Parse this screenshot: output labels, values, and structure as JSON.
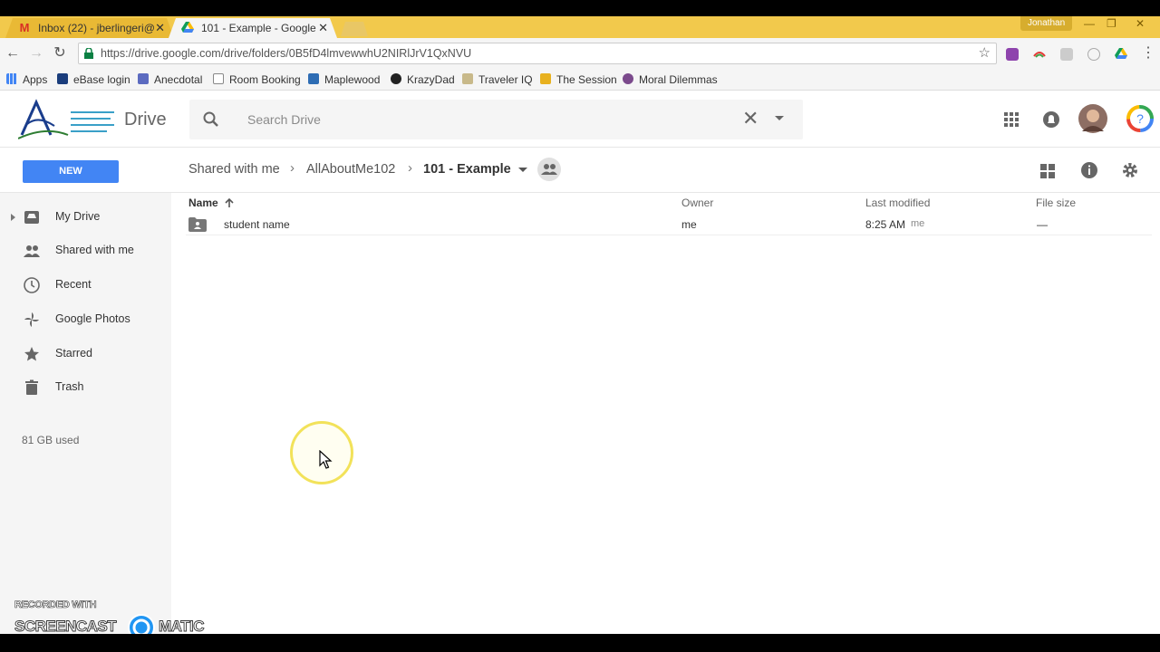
{
  "browser": {
    "tabs": [
      {
        "title": "Inbox (22) - jberlingeri@",
        "icon": "gmail-icon",
        "active": false
      },
      {
        "title": "101 - Example - Google",
        "icon": "google-drive-icon",
        "active": true
      }
    ],
    "profile_name": "Jonathan",
    "url": "https://drive.google.com/drive/folders/0B5fD4lmvewwhU2NIRlJrV1QxNVU",
    "bookmarks": [
      {
        "label": "Apps",
        "icon": "apps-grid-icon",
        "color": "#4285f4"
      },
      {
        "label": "eBase login",
        "icon": "ebase-icon",
        "color": "#1a3d7c"
      },
      {
        "label": "Anecdotal",
        "icon": "anecdotal-icon",
        "color": "#5c6bc0"
      },
      {
        "label": "Room Booking",
        "icon": "page-icon",
        "color": "#ffffff"
      },
      {
        "label": "Maplewood",
        "icon": "maplewood-icon",
        "color": "#2e6db4"
      },
      {
        "label": "KrazyDad",
        "icon": "krazydad-icon",
        "color": "#222222"
      },
      {
        "label": "Traveler IQ",
        "icon": "traveler-iq-icon",
        "color": "#c8b98a"
      },
      {
        "label": "The Session",
        "icon": "the-session-icon",
        "color": "#e8b11f"
      },
      {
        "label": "Moral Dilemmas",
        "icon": "moral-dilemmas-icon",
        "color": "#7b4a8c"
      }
    ]
  },
  "drive": {
    "app_name": "Drive",
    "search_placeholder": "Search Drive",
    "new_button": "NEW",
    "breadcrumbs": [
      "Shared with me",
      "AllAboutMe102",
      "101 - Example"
    ],
    "nav": [
      {
        "label": "My Drive",
        "icon": "my-drive-icon"
      },
      {
        "label": "Shared with me",
        "icon": "shared-with-me-icon"
      },
      {
        "label": "Recent",
        "icon": "clock-icon"
      },
      {
        "label": "Google Photos",
        "icon": "pinwheel-icon"
      },
      {
        "label": "Starred",
        "icon": "star-icon"
      },
      {
        "label": "Trash",
        "icon": "trash-icon"
      }
    ],
    "storage_used": "81 GB used",
    "columns": {
      "name": "Name",
      "owner": "Owner",
      "last_modified": "Last modified",
      "file_size": "File size"
    },
    "files": [
      {
        "name": "student name",
        "type": "shared-folder",
        "owner": "me",
        "modified": "8:25 AM",
        "modified_by": "me",
        "size": "—"
      }
    ],
    "accent_color": "#4285f4"
  },
  "watermark": {
    "line1": "RECORDED WITH",
    "brand_left": "SCREENCAST",
    "brand_right": "MATIC"
  }
}
